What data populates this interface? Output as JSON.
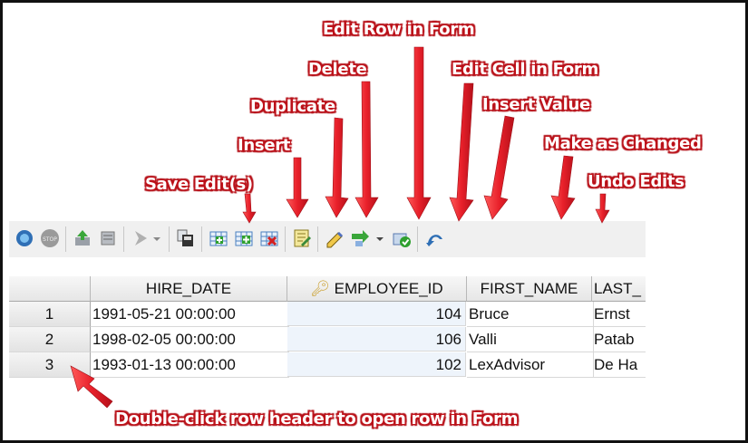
{
  "callouts": {
    "edit_row_in_form": "Edit Row in Form",
    "delete": "Delete",
    "edit_cell_in_form": "Edit Cell in Form",
    "duplicate": "Duplicate",
    "insert_value": "Insert Value",
    "insert": "Insert",
    "make_as_changed": "Make as Changed",
    "save_edits": "Save Edit(s)",
    "undo_edits": "Undo Edits",
    "double_click_tip": "Double-click row header to open row in Form"
  },
  "toolbar": {
    "icons": [
      "refresh-icon",
      "stop-icon",
      "export-icon",
      "filter-icon",
      "run-icon",
      "dropdown-icon",
      "save-edits-icon",
      "insert-row-icon",
      "duplicate-row-icon",
      "delete-row-icon",
      "edit-row-form-icon",
      "edit-cell-form-icon",
      "insert-value-icon",
      "dropdown-icon",
      "make-as-changed-icon",
      "undo-edits-icon"
    ]
  },
  "grid": {
    "columns": [
      "",
      "HIRE_DATE",
      "EMPLOYEE_ID",
      "FIRST_NAME",
      "LAST_"
    ],
    "key_column": "EMPLOYEE_ID",
    "rows": [
      {
        "num": "1",
        "hire_date": "1991-05-21 00:00:00",
        "employee_id": "104",
        "first_name": "Bruce",
        "last_name": "Ernst"
      },
      {
        "num": "2",
        "hire_date": "1998-02-05 00:00:00",
        "employee_id": "106",
        "first_name": "Valli",
        "last_name": "Patab"
      },
      {
        "num": "3",
        "hire_date": "1993-01-13 00:00:00",
        "employee_id": "102",
        "first_name": "LexAdvisor",
        "last_name": "De Ha"
      }
    ]
  },
  "colors": {
    "callout_red": "#e0262e",
    "arrow_red": "#e8202a",
    "frame": "#111111"
  }
}
